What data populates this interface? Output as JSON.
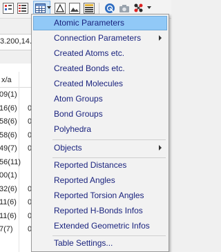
{
  "background": {
    "address_text": "3.200,14.",
    "column_header": "x/a",
    "col1": [
      "09(1)",
      "16(6)",
      "58(6)",
      "58(6)",
      "49(7)",
      "56(11)",
      "00(1)",
      "32(6)",
      "11(6)",
      "11(6)",
      "7(7)"
    ],
    "col2": [
      "",
      "0",
      "0",
      "0",
      "0",
      "",
      "",
      "0",
      "0",
      "0",
      "0"
    ]
  },
  "menu": {
    "items": [
      {
        "label": "Atomic Parameters",
        "highlighted": true,
        "submenu": false
      },
      {
        "label": "Connection Parameters",
        "highlighted": false,
        "submenu": true
      },
      {
        "label": "Created Atoms etc.",
        "highlighted": false,
        "submenu": false
      },
      {
        "label": "Created Bonds etc.",
        "highlighted": false,
        "submenu": false
      },
      {
        "label": "Created Molecules",
        "highlighted": false,
        "submenu": false
      },
      {
        "label": "Atom Groups",
        "highlighted": false,
        "submenu": false
      },
      {
        "label": "Bond Groups",
        "highlighted": false,
        "submenu": false
      },
      {
        "label": "Polyhedra",
        "highlighted": false,
        "submenu": false
      },
      {
        "label": "Objects",
        "highlighted": false,
        "submenu": true
      },
      {
        "label": "Reported Distances",
        "highlighted": false,
        "submenu": false
      },
      {
        "label": "Reported Angles",
        "highlighted": false,
        "submenu": false
      },
      {
        "label": "Reported Torsion Angles",
        "highlighted": false,
        "submenu": false
      },
      {
        "label": "Reported H-Bonds Infos",
        "highlighted": false,
        "submenu": false
      },
      {
        "label": "Extended Geometric Infos",
        "highlighted": false,
        "submenu": false
      },
      {
        "label": "Table Settings...",
        "highlighted": false,
        "submenu": false
      }
    ]
  },
  "colors": {
    "menu_text": "#1a237e",
    "highlight": "#91c9f7",
    "highlight_border": "#70a9d8"
  }
}
